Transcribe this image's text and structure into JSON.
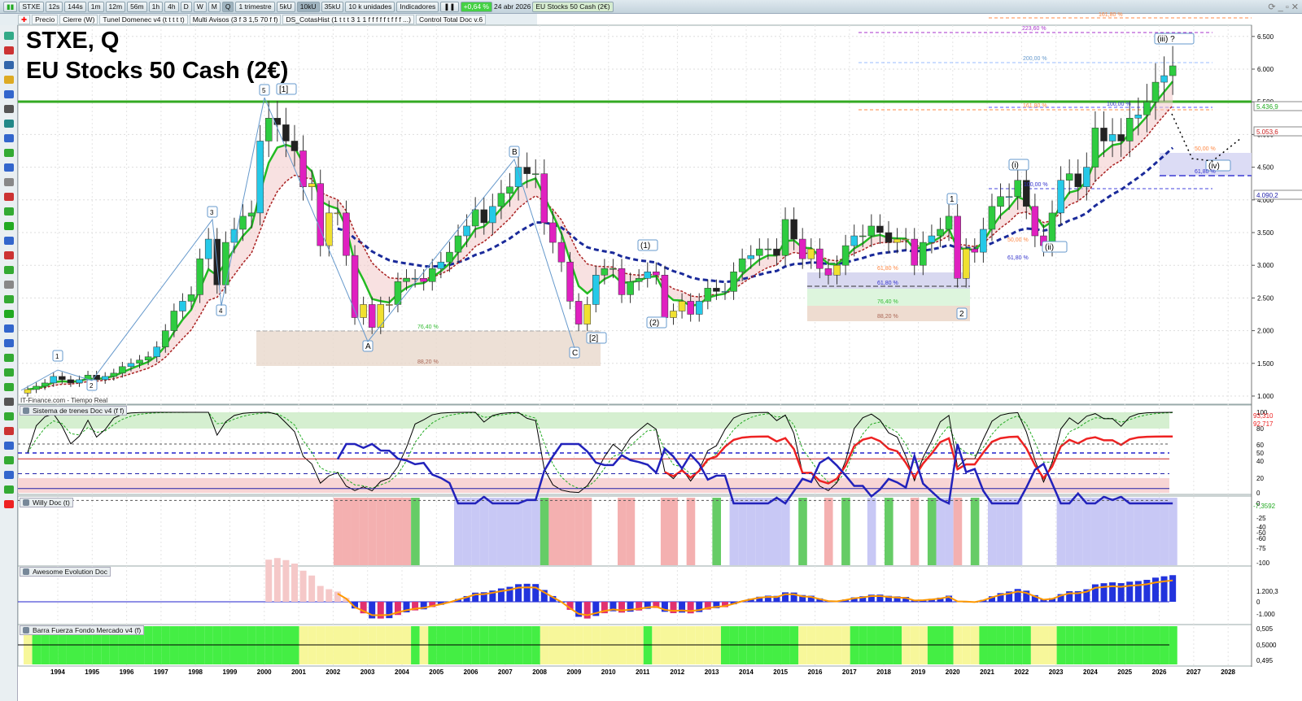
{
  "toolbar": {
    "symbol": "STXE",
    "timeframes": [
      "12s",
      "144s",
      "1m",
      "12m",
      "56m",
      "1h",
      "4h",
      "D",
      "W",
      "M",
      "Q"
    ],
    "active_tf": "Q",
    "period": "1 trimestre",
    "units": [
      "5kU",
      "10kU",
      "35kU"
    ],
    "active_unit": "10kU",
    "units_select": "10 k unidades",
    "indicators": "Indicadores",
    "change": "+0,64 %",
    "date": "24 abr 2026",
    "instrument": "EU Stocks 50 Cash (2€)"
  },
  "indicator_bar": [
    "Precio",
    "Cierre (W)",
    "Tunel Domenec v4 (t t t t t)",
    "Multi Avisos (3 f 3 1,5 70 f f)",
    "DS_CotasHist (1 t t t 3 1 1 f f f f f t f f f ...)",
    "Control Total Doc v.6"
  ],
  "chart": {
    "title_line1": "STXE, Q",
    "title_line2": "EU Stocks 50 Cash (2€)",
    "source": "IT-Finance.com - Tiempo Real",
    "price_ticks": [
      "6.500",
      "6.000",
      "5.500",
      "5.000",
      "4.500",
      "4.000",
      "3.500",
      "3.000",
      "2.500",
      "2.000",
      "1.500",
      "1.000"
    ],
    "badges": {
      "green": "5.436,9",
      "red": "5.053,6",
      "blue": "4.090,2"
    },
    "wave_labels": [
      "1",
      "2",
      "3",
      "4",
      "5",
      "[1]",
      "A",
      "B",
      "C",
      "[2]",
      "(1)",
      "(2)",
      "1",
      "2",
      "(i)",
      "(ii)",
      "(iii) ?",
      "(iv)"
    ],
    "fib_labels": [
      "223,60 %",
      "200,00 %",
      "161,80 %",
      "100,00 %",
      "100,00 %",
      "50,00 %",
      "61,80 %",
      "76,40 %",
      "88,20 %",
      "61,80 %",
      "76,40 %",
      "88,20 %",
      "61,80 %",
      "50,00 %",
      "61,80 %",
      "161,80 %"
    ]
  },
  "panes": [
    {
      "label": "Sistema de trenes Doc v4 (f f)",
      "ticks": [
        "100",
        "80",
        "60",
        "50",
        "40",
        "20",
        "0"
      ],
      "badges": [
        "93,310",
        "92,717"
      ]
    },
    {
      "label": "Willy Doc (t)",
      "ticks": [
        "0",
        "-25",
        "-40",
        "-50",
        "-60",
        "-75",
        "-100"
      ],
      "badges": [
        "-7,3592"
      ]
    },
    {
      "label": "Awesome Evolution Doc",
      "ticks": [
        "1.200,3",
        "0",
        "-1.000"
      ]
    },
    {
      "label": "Barra Fuerza Fondo Mercado v4 (f)",
      "ticks": [
        "0,505",
        "0,5000",
        "0,495"
      ]
    }
  ],
  "years": [
    "1994",
    "1995",
    "1996",
    "1997",
    "1998",
    "1999",
    "2000",
    "2001",
    "2002",
    "2003",
    "2004",
    "2005",
    "2006",
    "2007",
    "2008",
    "2009",
    "2010",
    "2011",
    "2012",
    "2013",
    "2014",
    "2015",
    "2016",
    "2017",
    "2018",
    "2019",
    "2020",
    "2021",
    "2022",
    "2023",
    "2024",
    "2025",
    "2026",
    "2027",
    "2028"
  ],
  "chart_data": {
    "type": "candlestick",
    "title": "STXE, Q",
    "start": "1993 Q1",
    "interval": "quarter",
    "ylim": [
      1000,
      6700
    ],
    "closes": [
      1100,
      1150,
      1200,
      1300,
      1250,
      1200,
      1250,
      1320,
      1250,
      1300,
      1350,
      1450,
      1500,
      1550,
      1600,
      1750,
      2000,
      2300,
      2450,
      2550,
      3100,
      3400,
      2700,
      3350,
      3550,
      3750,
      3800,
      4900,
      5250,
      5150,
      4900,
      4750,
      4200,
      4250,
      3300,
      3800,
      3800,
      3150,
      2200,
      2400,
      2050,
      2400,
      2400,
      2750,
      2800,
      2800,
      2750,
      2950,
      3050,
      3200,
      3450,
      3600,
      3850,
      3650,
      3900,
      4100,
      4200,
      4500,
      4400,
      4400,
      3650,
      3350,
      3050,
      2450,
      2100,
      2400,
      2850,
      2950,
      2950,
      2550,
      2750,
      2800,
      2900,
      2850,
      2200,
      2300,
      2450,
      2250,
      2450,
      2650,
      2600,
      2600,
      2900,
      3100,
      3150,
      3250,
      3250,
      3150,
      3700,
      3400,
      3100,
      3250,
      2950,
      2850,
      3000,
      3300,
      3450,
      3450,
      3600,
      3500,
      3350,
      3400,
      3400,
      3000,
      3350,
      3450,
      3550,
      3750,
      2800,
      3250,
      3200,
      3550,
      3900,
      4050,
      4050,
      4300,
      3900,
      3450,
      3300,
      3800,
      4300,
      4400,
      4200,
      4500,
      5100,
      4900,
      5000,
      4900,
      5250,
      5300,
      5500,
      5800,
      5900,
      6050
    ]
  },
  "colors": {
    "up": "#2ecc40",
    "down": "#222222",
    "ema_fast": "#22bb22",
    "ema_slow": "#aa2222",
    "ema_long": "#1a2a9a",
    "level": "#33aa22"
  }
}
